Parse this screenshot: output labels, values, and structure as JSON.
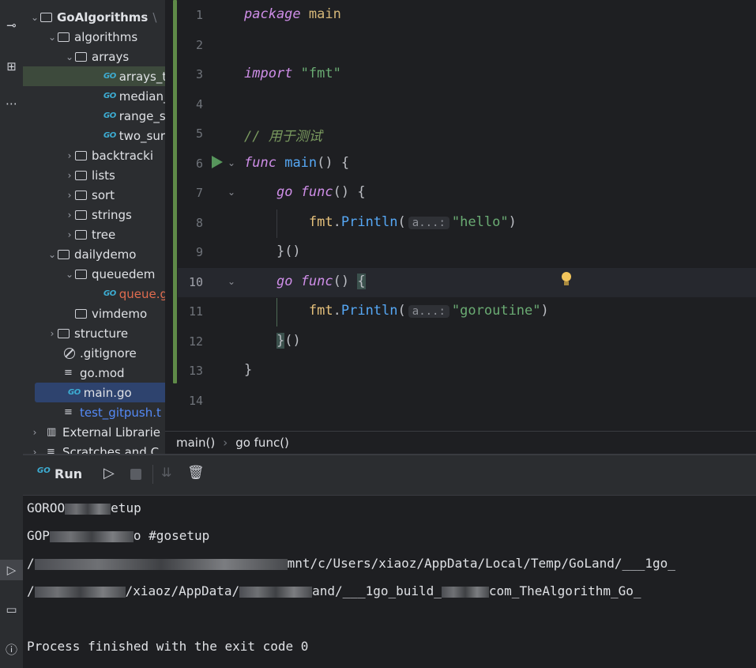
{
  "project": {
    "root": "GoAlgorithms",
    "root_suffix": "\\",
    "items": [
      {
        "label": "algorithms"
      },
      {
        "label": "arrays"
      },
      {
        "label": "arrays_t"
      },
      {
        "label": "median_"
      },
      {
        "label": "range_s"
      },
      {
        "label": "two_sur"
      },
      {
        "label": "backtracki"
      },
      {
        "label": "lists"
      },
      {
        "label": "sort"
      },
      {
        "label": "strings"
      },
      {
        "label": "tree"
      },
      {
        "label": "dailydemo"
      },
      {
        "label": "queuedem"
      },
      {
        "label": "queue.g"
      },
      {
        "label": "vimdemo"
      },
      {
        "label": "structure"
      },
      {
        "label": ".gitignore"
      },
      {
        "label": "go.mod"
      },
      {
        "label": "main.go"
      },
      {
        "label": "test_gitpush.t"
      },
      {
        "label": "External Librarie"
      },
      {
        "label": "Scratches and C"
      }
    ]
  },
  "editor": {
    "line_numbers": [
      "1",
      "2",
      "3",
      "4",
      "5",
      "6",
      "7",
      "8",
      "9",
      "10",
      "11",
      "12",
      "13",
      "14"
    ],
    "code": {
      "l1_kw": "package",
      "l1_name": "main",
      "l3_kw": "import",
      "l3_str": "\"fmt\"",
      "l5_comment": "// 用于测试",
      "l6_kw": "func",
      "l6_name": "main",
      "l6_rest": "() {",
      "l7_go": "go",
      "l7_func": "func",
      "l7_rest": "() {",
      "l8_pkg": "fmt",
      "l8_dot": ".",
      "l8_fn": "Println",
      "l8_open": "(",
      "l8_hint": "a...:",
      "l8_str": "\"hello\"",
      "l8_close": ")",
      "l9": "}()",
      "l10_go": "go",
      "l10_func": "func",
      "l10_rest": "() ",
      "l10_brace": "{",
      "l11_pkg": "fmt",
      "l11_dot": ".",
      "l11_fn": "Println",
      "l11_open": "(",
      "l11_hint": "a...:",
      "l11_str": "\"goroutine\"",
      "l11_close": ")",
      "l12_brace": "}",
      "l12_rest": "()",
      "l13": "}"
    }
  },
  "breadcrumb": {
    "items": [
      "main()",
      "go func()"
    ],
    "separator": "›"
  },
  "run": {
    "tab_label": "Run",
    "output": {
      "l1_a": "GOROO",
      "l1_b": "etup",
      "l2_a": "GOP",
      "l2_b": "o #gosetup",
      "l3_a": "/",
      "l3_b": "mnt/c/Users/xiaoz/AppData/Local/Temp/GoLand/___1go_",
      "l4_a": "/",
      "l4_b": "/xiaoz/AppData/",
      "l4_c": "and/___1go_build_",
      "l4_d": "com_TheAlgorithm_Go_",
      "l6": "Process finished with the exit code 0"
    }
  }
}
